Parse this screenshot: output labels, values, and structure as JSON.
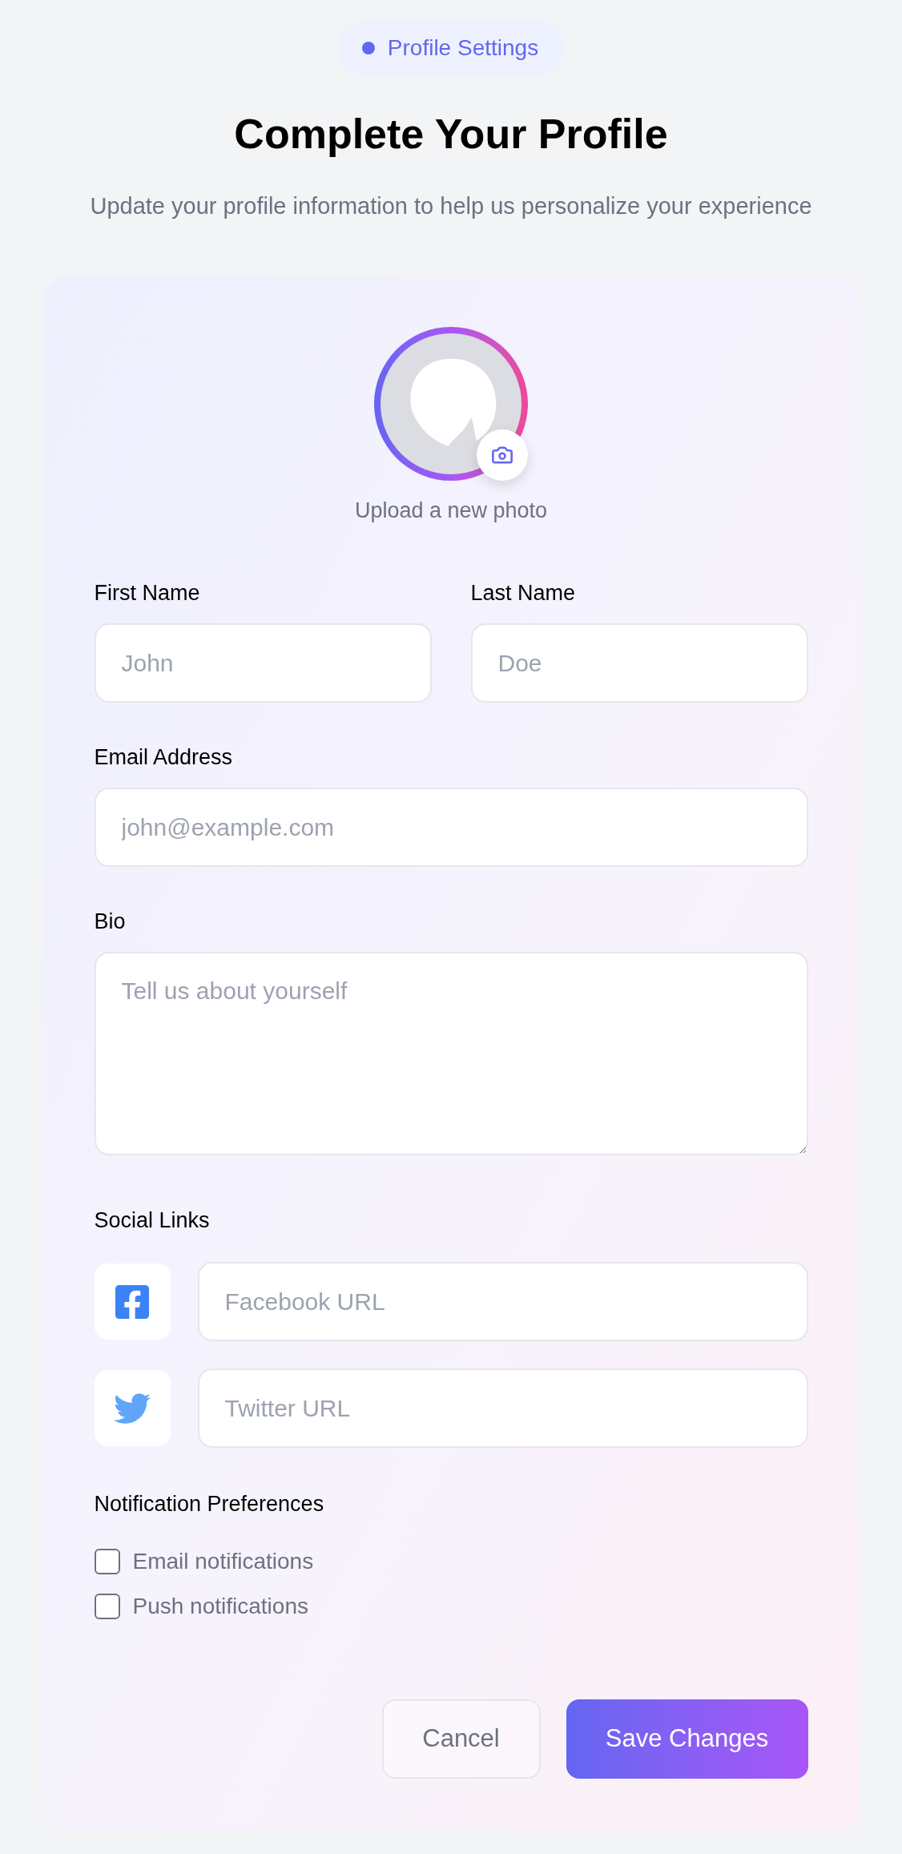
{
  "badge": {
    "label": "Profile Settings"
  },
  "heading": "Complete Your Profile",
  "subheading": "Update your profile information to help us personalize your experience",
  "photo": {
    "caption": "Upload a new photo"
  },
  "name_fields": [
    {
      "label": "First Name",
      "placeholder": "John"
    },
    {
      "label": "Last Name",
      "placeholder": "Doe"
    }
  ],
  "email": {
    "label": "Email Address",
    "placeholder": "john@example.com"
  },
  "bio": {
    "label": "Bio",
    "placeholder": "Tell us about yourself"
  },
  "social_links": {
    "label": "Social Links",
    "items": [
      {
        "kind": "facebook",
        "placeholder": "Facebook URL"
      },
      {
        "kind": "twitter",
        "placeholder": "Twitter URL"
      }
    ]
  },
  "notifications": {
    "label": "Notification Preferences",
    "options": [
      {
        "label": "Email notifications",
        "checked": false
      },
      {
        "label": "Push notifications",
        "checked": false
      }
    ]
  },
  "buttons": [
    {
      "kind": "secondary",
      "label": "Cancel"
    },
    {
      "kind": "primary",
      "label": "Save Changes"
    }
  ]
}
